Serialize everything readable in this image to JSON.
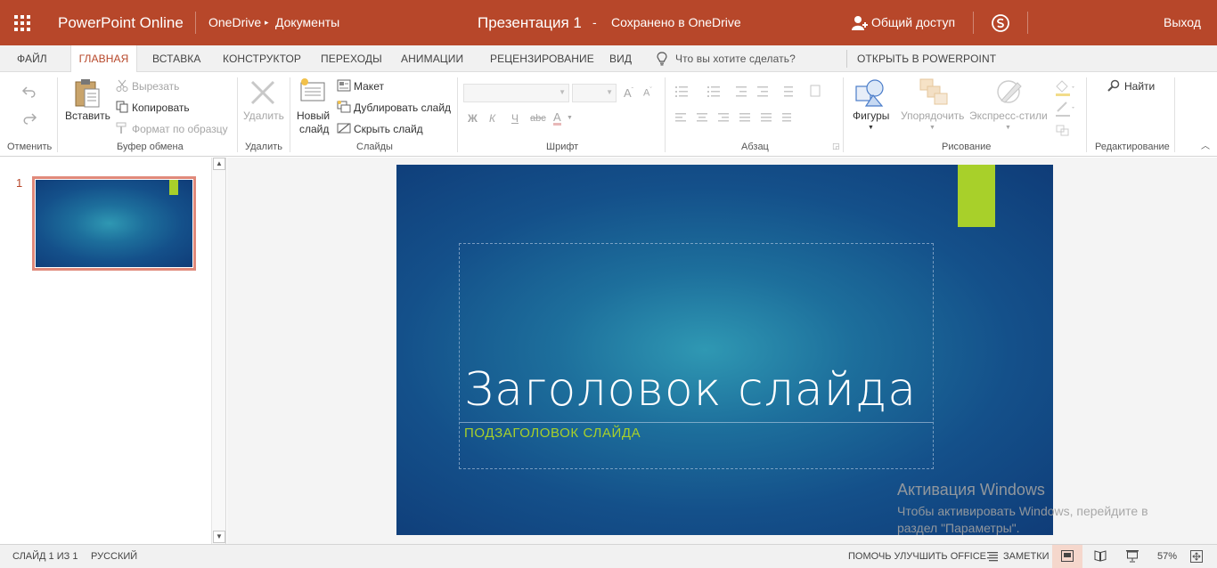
{
  "topbar": {
    "app_name": "PowerPoint Online",
    "breadcrumb_root": "OneDrive",
    "breadcrumb_folder": "Документы",
    "doc_title": "Презентация 1",
    "title_separator": "-",
    "save_status": "Сохранено в OneDrive",
    "share_label": "Общий доступ",
    "signout_label": "Выход"
  },
  "tabs": {
    "file": "ФАЙЛ",
    "home": "ГЛАВНАЯ",
    "insert": "ВСТАВКА",
    "design": "КОНСТРУКТОР",
    "transitions": "ПЕРЕХОДЫ",
    "animations": "АНИМАЦИИ",
    "review": "РЕЦЕНЗИРОВАНИЕ",
    "view": "ВИД",
    "tell_me_placeholder": "Что вы хотите сделать?",
    "open_in_app": "ОТКРЫТЬ В POWERPOINT"
  },
  "ribbon": {
    "undo_group": "Отменить",
    "paste": "Вставить",
    "cut": "Вырезать",
    "copy": "Копировать",
    "format_painter": "Формат по образцу",
    "clipboard_group": "Буфер обмена",
    "delete": "Удалить",
    "delete_group": "Удалить",
    "new_slide_line1": "Новый",
    "new_slide_line2": "слайд",
    "layout": "Макет",
    "duplicate_slide": "Дублировать слайд",
    "hide_slide": "Скрыть слайд",
    "slides_group": "Слайды",
    "bold": "Ж",
    "italic": "К",
    "underline": "Ч",
    "strikethrough": "abc",
    "font_color": "A",
    "font_group": "Шрифт",
    "paragraph_group": "Абзац",
    "shapes": "Фигуры",
    "arrange": "Упорядочить",
    "quick_styles": "Экспресс-стили",
    "drawing_group": "Рисование",
    "find": "Найти",
    "editing_group": "Редактирование"
  },
  "thumbnails": [
    {
      "number": "1"
    }
  ],
  "slide": {
    "title": "Заголовок слайда",
    "subtitle": "ПОДЗАГОЛОВОК СЛАЙДА"
  },
  "watermark": {
    "line1": "Активация Windows",
    "line2": "Чтобы активировать Windows, перейдите в",
    "line3": "раздел \"Параметры\"."
  },
  "statusbar": {
    "slide_count": "СЛАЙД 1 ИЗ 1",
    "language": "РУССКИЙ",
    "help_improve": "ПОМОЧЬ УЛУЧШИТЬ OFFICE",
    "notes": "ЗАМЕТКИ",
    "zoom": "57%"
  },
  "colors": {
    "accent": "#b7472a",
    "slide_accent": "#a8d02a"
  }
}
